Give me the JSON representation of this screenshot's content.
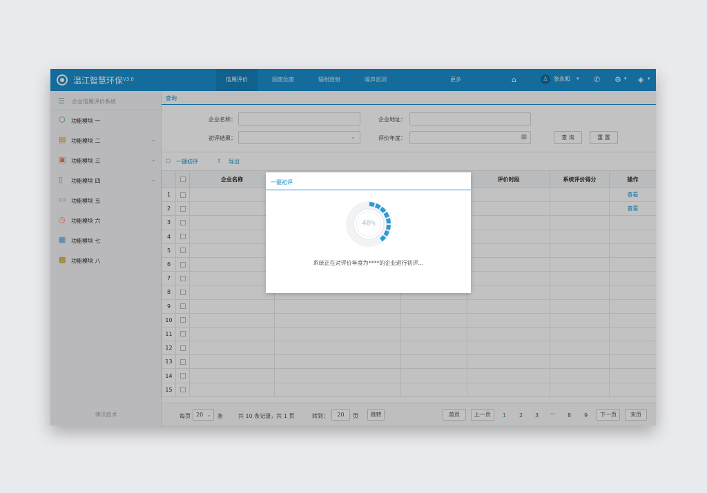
{
  "header": {
    "title": "温江智慧环保",
    "version": "V3.0",
    "nav": [
      "信用评价",
      "固废危废",
      "辐射放射",
      "噪声监测",
      "更多"
    ],
    "user": "张永和"
  },
  "sidebar": {
    "system": "企业信用评价系统",
    "items": [
      {
        "label": "功能模块 一",
        "icon": "cube-icon",
        "color": "#4caf50",
        "expandable": false
      },
      {
        "label": "功能模块 二",
        "icon": "document-icon",
        "color": "#d4a017",
        "expandable": true
      },
      {
        "label": "功能模块 三",
        "icon": "clipboard-icon",
        "color": "#ff7043",
        "expandable": true
      },
      {
        "label": "功能模块 四",
        "icon": "file-icon",
        "color": "#999999",
        "expandable": true
      },
      {
        "label": "功能模块 五",
        "icon": "folder-icon",
        "color": "#e57373",
        "expandable": false
      },
      {
        "label": "功能模块 六",
        "icon": "clock-icon",
        "color": "#ff8a65",
        "expandable": false
      },
      {
        "label": "功能模块 七",
        "icon": "network-icon",
        "color": "#42a5f5",
        "expandable": false
      },
      {
        "label": "功能模块 八",
        "icon": "briefcase-icon",
        "color": "#c8a000",
        "expandable": false
      }
    ],
    "footer": "博讯技术"
  },
  "query": {
    "tab": "查询",
    "company_name_label": "企业名称：",
    "company_addr_label": "企业地址：",
    "result_label": "初评结果：",
    "year_label": "评价年度：",
    "search_btn": "查 询",
    "reset_btn": "重 置"
  },
  "toolbar": {
    "one_click": "一键初评",
    "export": "导出"
  },
  "table": {
    "headers": [
      "",
      "",
      "企业名称",
      "",
      "",
      "评价时段",
      "系统评价得分",
      "操作"
    ],
    "row_numbers": [
      "1",
      "2",
      "3",
      "4",
      "5",
      "6",
      "7",
      "8",
      "9",
      "10",
      "11",
      "12",
      "13",
      "14",
      "15"
    ],
    "view_label": "查看",
    "view_rows": 2
  },
  "pager": {
    "per_page_prefix": "每页",
    "per_page_value": "20",
    "per_page_suffix": "条",
    "summary": "共 10 条记录，共 1 页",
    "goto_label": "转到：",
    "goto_value": "20",
    "page_unit": "页",
    "jump": "跳转",
    "first": "首页",
    "prev": "上一页",
    "pages": [
      "1",
      "2",
      "3",
      "···",
      "8",
      "9"
    ],
    "next": "下一页",
    "last": "末页"
  },
  "modal": {
    "title": "一键初评",
    "progress_text": "40%",
    "progress": 0.4,
    "message": "系统正在对评价年度为****的企业进行初评..."
  },
  "colors": {
    "primary": "#1b8fce",
    "progress": "#2b9ad8"
  }
}
